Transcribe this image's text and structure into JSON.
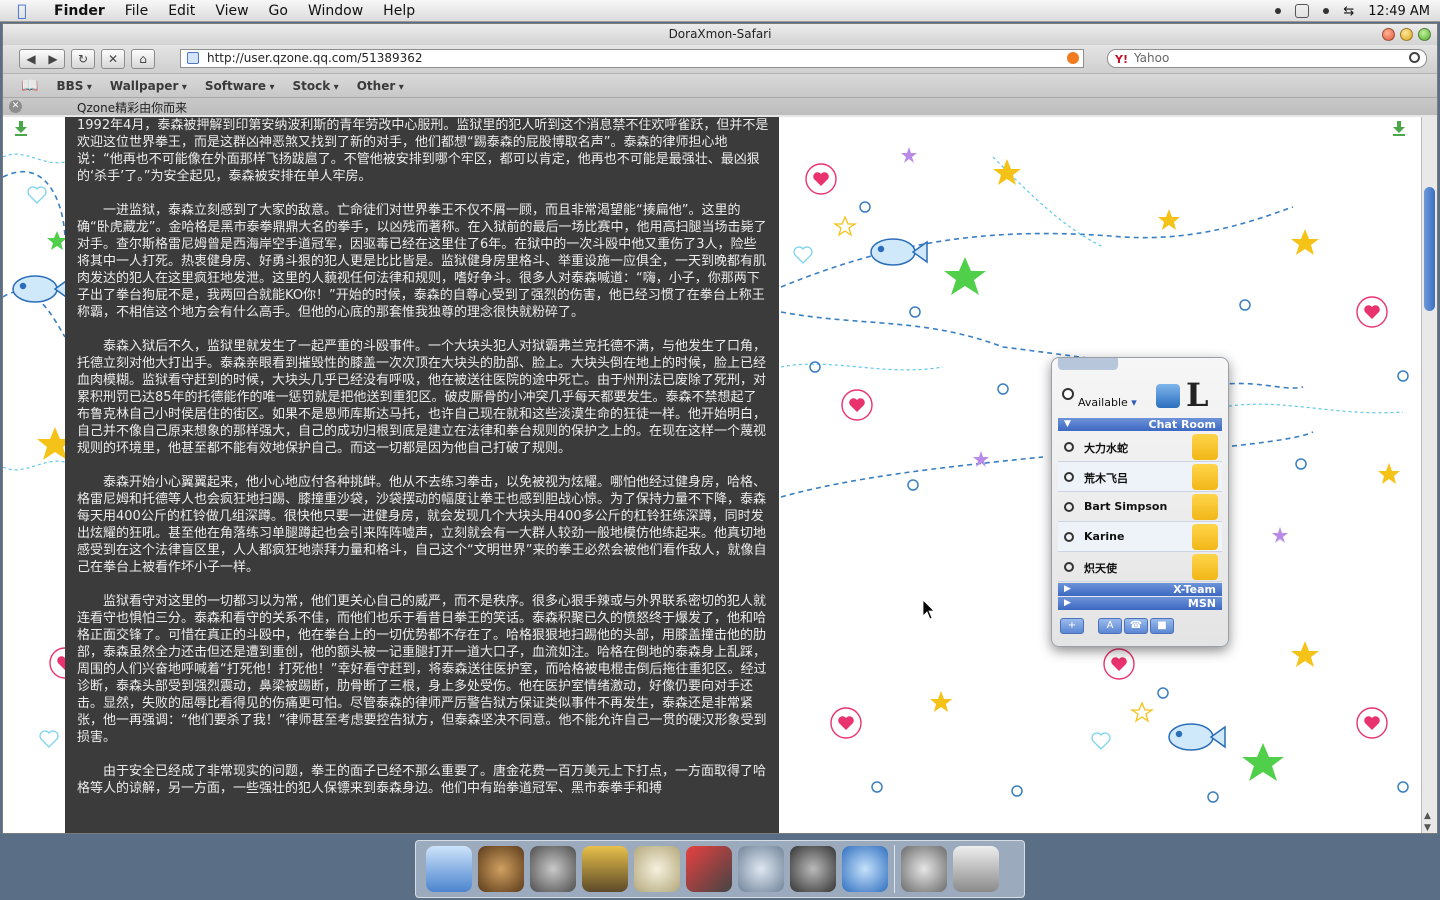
{
  "menubar": {
    "items": [
      "Finder",
      "File",
      "Edit",
      "View",
      "Go",
      "Window",
      "Help"
    ],
    "clock": "12:49 AM"
  },
  "window": {
    "title": "DoraXmon-Safari"
  },
  "toolbar": {
    "url": "http://user.qzone.qq.com/51389362",
    "search_placeholder": "Yahoo"
  },
  "bookmarks": [
    "BBS",
    "Wallpaper",
    "Software",
    "Stock",
    "Other"
  ],
  "tab": {
    "title": "Qzone精彩由你而来"
  },
  "article": {
    "paragraphs": [
      "1992年4月，泰森被押解到印第安纳波利斯的青年劳改中心服刑。监狱里的犯人听到这个消息禁不住欢呼雀跃，但并不是欢迎这位世界拳王，而是这群凶神恶煞又找到了新的对手，他们都想“踢泰森的屁股博取名声”。泰森的律师担心地说：“他再也不可能像在外面那样飞扬跋扈了。不管他被安排到哪个牢区，都可以肯定，他再也不可能是最强壮、最凶狠的‘杀手’了。”为安全起见，泰森被安排在单人牢房。",
      "一进监狱，泰森立刻感到了大家的敌意。亡命徒们对世界拳王不仅不屑一顾，而且非常渴望能“揍扁他”。这里的确“卧虎藏龙”。金哈格是黑市泰拳鼎鼎大名的拳手，以凶残而著称。在入狱前的最后一场比赛中，他用高扫腿当场击毙了对手。查尔斯格雷尼姆曾是西海岸空手道冠军，因驱毒已经在这里住了6年。在狱中的一次斗殴中他又重伤了3人，险些将其中一人打死。热衷健身房、好勇斗狠的犯人更是比比皆是。监狱健身房里格斗、举重设施一应俱全，一天到晚都有肌肉发达的犯人在这里疯狂地发泄。这里的人藐视任何法律和规则，嗜好争斗。很多人对泰森喊道：“嗨，小子，你那两下子出了拳台狗屁不是，我两回合就能KO你！”开始的时候，泰森的自尊心受到了强烈的伤害，他已经习惯了在拳台上称王称霸，不相信这个地方会有什么高手。但他的心底的那套惟我独尊的理念很快就粉碎了。",
      "泰森入狱后不久，监狱里就发生了一起严重的斗殴事件。一个大块头犯人对狱霸弗兰克托德不满，与他发生了口角，托德立刻对他大打出手。泰森亲眼看到摧毁性的膝盖一次次顶在大块头的肋部、脸上。大块头倒在地上的时候，脸上已经血肉模糊。监狱看守赶到的时候，大块头几乎已经没有呼吸，他在被送往医院的途中死亡。由于州刑法已废除了死刑，对累积刑罚已达85年的托德能作的唯一惩罚就是把他送到重犯区。破皮厮骨的小冲突几乎每天都要发生。泰森不禁想起了布鲁克林自己小时侯居住的街区。如果不是恩师库斯达马托，也许自己现在就和这些淡漠生命的狂徒一样。他开始明白，自己并不像自己原来想象的那样强大，自己的成功归根到底是建立在法律和拳台规则的保护之上的。在现在这样一个蔑视规则的环境里，他甚至都不能有效地保护自己。而这一切都是因为他自己打破了规则。",
      "泰森开始小心翼翼起来，他小心地应付各种挑衅。他从不去练习拳击，以免被视为炫耀。哪怕他经过健身房，哈格、格雷尼姆和托德等人也会疯狂地扫踢、膝撞重沙袋，沙袋摆动的幅度让拳王也感到胆战心惊。为了保持力量不下降，泰森每天用400公斤的杠铃做几组深蹲。很快他只要一进健身房，就会发现几个大块头用400多公斤的杠铃狂练深蹲，同时发出炫耀的狂吼。甚至他在角落练习单腿蹲起也会引来阵阵嘘声，立刻就会有一大群人较劲一般地模仿他练起来。他真切地感受到在这个法律盲区里，人人都疯狂地崇拜力量和格斗，自己这个“文明世界”来的拳王必然会被他们看作敌人，就像自己在拳台上被看作坏小子一样。",
      "监狱看守对这里的一切都习以为常，他们更关心自己的威严，而不是秩序。很多心狠手辣或与外界联系密切的犯人就连看守也惧怕三分。泰森和看守的关系不佳，而他们也乐于看昔日拳王的笑话。泰森积聚已久的愤怒终于爆发了，他和哈格正面交锋了。可惜在真正的斗殴中，他在拳台上的一切优势都不存在了。哈格狠狠地扫踢他的头部，用膝盖撞击他的肋部，泰森虽然全力还击但还是遭到重创，他的额头被一记重腿打开一道大口子，血流如注。哈格在倒地的泰森身上乱踩，周围的人们兴奋地呼喊着“打死他！打死他！”幸好看守赶到，将泰森送往医护室，而哈格被电棍击倒后拖往重犯区。经过诊断，泰森头部受到强烈震动，鼻梁被踢断，肋骨断了三根，身上多处受伤。他在医护室情绪激动，好像仍要向对手还击。显然，失败的屈辱比看得见的伤痛更可怕。尽管泰森的律师严厉警告狱方保证类似事件不再发生，泰森还是非常紧张，他一再强调：“他们要杀了我！”律师甚至考虑要控告狱方，但泰森坚决不同意。他不能允许自己一贯的硬汉形象受到损害。",
      "由于安全已经成了非常现实的问题，拳王的面子已经不那么重要了。唐金花费一百万美元上下打点，一方面取得了哈格等人的谅解，另一方面，一些强壮的犯人保镖来到泰森身边。他们中有跆拳道冠军、黑市泰拳手和搏"
    ]
  },
  "chat": {
    "status": "Available",
    "logo": "L",
    "groups": [
      "Chat Room",
      "X-Team",
      "MSN"
    ],
    "contacts": [
      "大力水蛇",
      "荒木飞吕",
      "Bart Simpson",
      "Karine",
      "炽天使"
    ],
    "buttons": [
      "+",
      "A"
    ]
  },
  "colors": {
    "accent": "#3d68c2",
    "article_bg": "#3b3b3b",
    "heart": "#e8336e",
    "star_yellow": "#f5c218",
    "star_green": "#4fcf4a",
    "star_purple": "#b98be6"
  }
}
